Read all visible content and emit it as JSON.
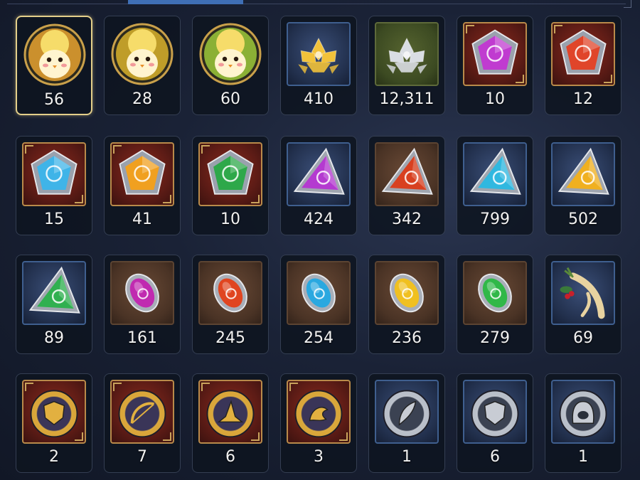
{
  "inventory": {
    "rows": [
      {
        "items": [
          {
            "name": "fire-pet-portrait-icon",
            "count": "56",
            "frame": "portrait",
            "kind": "portrait",
            "color": "#e8a230",
            "selected": true
          },
          {
            "name": "earth-pet-portrait-icon",
            "count": "28",
            "frame": "portrait",
            "kind": "portrait",
            "color": "#d9b12c"
          },
          {
            "name": "leaf-pet-portrait-icon",
            "count": "60",
            "frame": "portrait",
            "kind": "portrait",
            "color": "#9cc83a"
          },
          {
            "name": "gold-lotus-icon",
            "count": "410",
            "frame": "blue",
            "kind": "lotus",
            "color": "#f2c23a"
          },
          {
            "name": "silver-lotus-icon",
            "count": "12,311",
            "frame": "olive",
            "kind": "lotus",
            "color": "#d9dde3"
          },
          {
            "name": "dark-pentagon-gem-icon",
            "count": "10",
            "frame": "gold",
            "kind": "pentagon",
            "color": "#c03bd0"
          },
          {
            "name": "fire-pentagon-gem-icon",
            "count": "12",
            "frame": "gold",
            "kind": "pentagon",
            "color": "#e0452a"
          }
        ]
      },
      {
        "items": [
          {
            "name": "ice-pentagon-gem-icon",
            "count": "15",
            "frame": "gold",
            "kind": "pentagon",
            "color": "#3fb4e8"
          },
          {
            "name": "light-pentagon-gem-icon",
            "count": "41",
            "frame": "gold",
            "kind": "pentagon",
            "color": "#f0a020"
          },
          {
            "name": "wind-pentagon-gem-icon",
            "count": "10",
            "frame": "gold",
            "kind": "pentagon",
            "color": "#2ea84a"
          },
          {
            "name": "dark-triangle-gem-icon",
            "count": "424",
            "frame": "blue",
            "kind": "triangle",
            "color": "#b43ad0"
          },
          {
            "name": "fire-triangle-gem-icon",
            "count": "342",
            "frame": "brown",
            "kind": "triangle",
            "color": "#d84020"
          },
          {
            "name": "ice-triangle-gem-icon",
            "count": "799",
            "frame": "blue",
            "kind": "triangle",
            "color": "#30b8e0"
          },
          {
            "name": "light-triangle-gem-icon",
            "count": "502",
            "frame": "blue",
            "kind": "triangle",
            "color": "#f0b020"
          }
        ]
      },
      {
        "items": [
          {
            "name": "wind-triangle-gem-icon",
            "count": "89",
            "frame": "blue",
            "kind": "triangle",
            "color": "#30b050"
          },
          {
            "name": "dark-oval-gem-icon",
            "count": "161",
            "frame": "brown",
            "kind": "oval",
            "color": "#c02ab0"
          },
          {
            "name": "fire-oval-gem-icon",
            "count": "245",
            "frame": "brown",
            "kind": "oval",
            "color": "#e04520"
          },
          {
            "name": "ice-oval-gem-icon",
            "count": "254",
            "frame": "brown",
            "kind": "oval",
            "color": "#2aa8e0"
          },
          {
            "name": "light-oval-gem-icon",
            "count": "236",
            "frame": "brown",
            "kind": "oval",
            "color": "#f0c020"
          },
          {
            "name": "wind-oval-gem-icon",
            "count": "279",
            "frame": "brown",
            "kind": "oval",
            "color": "#30b848"
          },
          {
            "name": "ginseng-root-icon",
            "count": "69",
            "frame": "blue",
            "kind": "root",
            "color": "#e8d3a0"
          }
        ]
      },
      {
        "items": [
          {
            "name": "gold-shield-medal-icon",
            "count": "2",
            "frame": "gold",
            "kind": "medal-gold",
            "color": "#e2b040",
            "glyph": "shield"
          },
          {
            "name": "gold-bow-medal-icon",
            "count": "7",
            "frame": "gold",
            "kind": "medal-gold",
            "color": "#e2b040",
            "glyph": "bow"
          },
          {
            "name": "gold-wizard-hat-medal-icon",
            "count": "6",
            "frame": "gold",
            "kind": "medal-gold",
            "color": "#e2b040",
            "glyph": "hat"
          },
          {
            "name": "gold-dragon-medal-icon",
            "count": "3",
            "frame": "gold",
            "kind": "medal-gold",
            "color": "#e2b040",
            "glyph": "dragon"
          },
          {
            "name": "silver-feather-medal-icon",
            "count": "1",
            "frame": "blue",
            "kind": "medal-silver",
            "color": "#c8ccd4",
            "glyph": "feather"
          },
          {
            "name": "silver-shield-medal-icon",
            "count": "6",
            "frame": "blue",
            "kind": "medal-silver",
            "color": "#c8ccd4",
            "glyph": "shield"
          },
          {
            "name": "silver-hood-medal-icon",
            "count": "1",
            "frame": "blue",
            "kind": "medal-silver",
            "color": "#c8ccd4",
            "glyph": "hood"
          }
        ]
      }
    ]
  }
}
